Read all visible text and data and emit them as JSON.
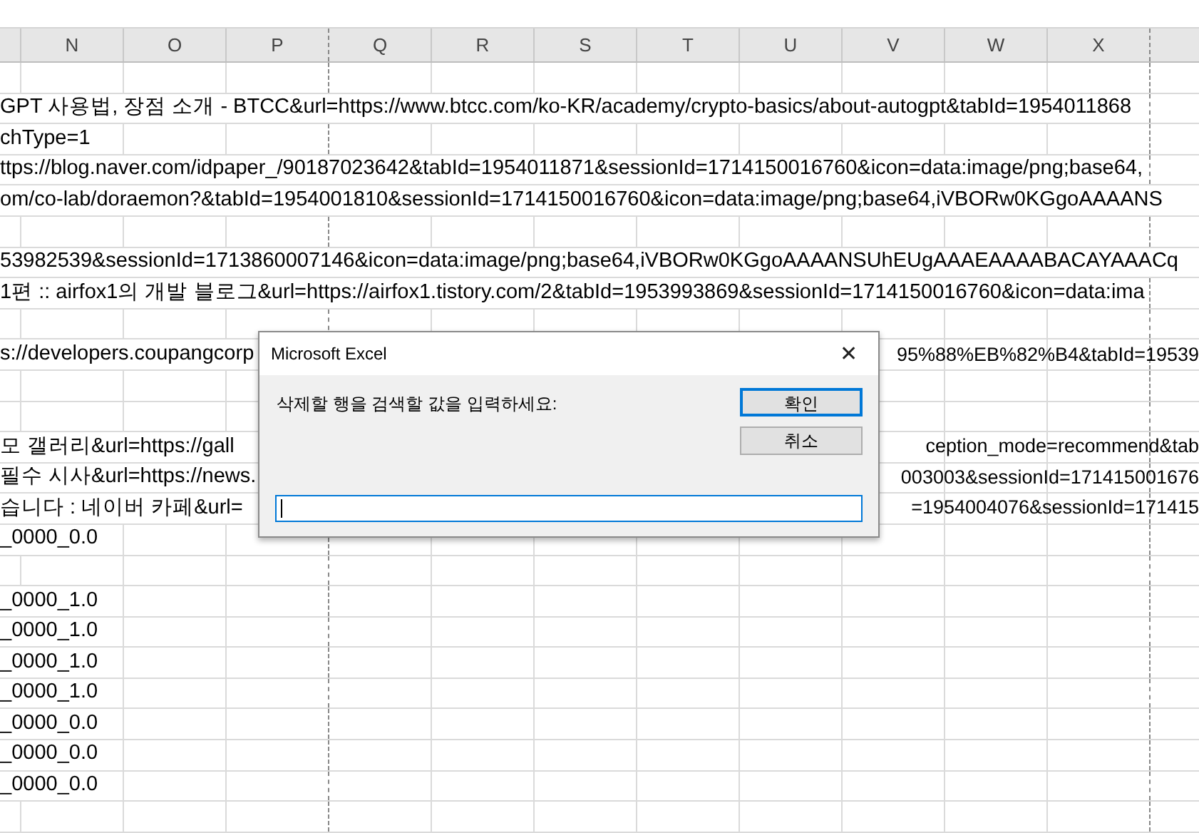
{
  "column_headers": [
    "N",
    "O",
    "P",
    "Q",
    "R",
    "S",
    "T",
    "U",
    "V",
    "W",
    "X"
  ],
  "rows": [
    {},
    {
      "text": "GPT 사용법, 장점 소개 - BTCC&url=https://www.btcc.com/ko-KR/academy/crypto-basics/about-autogpt&tabId=1954011868"
    },
    {
      "text": "chType=1"
    },
    {
      "text": "ttps://blog.naver.com/idpaper_/90187023642&tabId=1954011871&sessionId=1714150016760&icon=data:image/png;base64,"
    },
    {
      "text": "om/co-lab/doraemon?&tabId=1954001810&sessionId=1714150016760&icon=data:image/png;base64,iVBORw0KGgoAAAANS"
    },
    {},
    {
      "text": "53982539&sessionId=1713860007146&icon=data:image/png;base64,iVBORw0KGgoAAAANSUhEUgAAAEAAAABACAYAAACq"
    },
    {
      "text": "1편 :: airfox1의 개발 블로그&url=https://airfox1.tistory.com/2&tabId=1953993869&sessionId=1714150016760&icon=data:ima"
    },
    {},
    {
      "text": "s://developers.coupangcorp",
      "text_right": "95%88%EB%82%B4&tabId=19539"
    },
    {},
    {},
    {
      "text": "모 갤러리&url=https://gall",
      "text_right": "ception_mode=recommend&tab"
    },
    {
      "text": "필수 시사&url=https://news.",
      "text_right": "003003&sessionId=171415001676"
    },
    {
      "text": "습니다 : 네이버 카페&url=",
      "text_right": "=1954004076&sessionId=171415"
    },
    {
      "text": "_0000_0.0"
    },
    {},
    {
      "text": "_0000_1.0"
    },
    {
      "text": "_0000_1.0"
    },
    {
      "text": "_0000_1.0"
    },
    {
      "text": "_0000_1.0"
    },
    {
      "text": "_0000_0.0"
    },
    {
      "text": "_0000_0.0"
    },
    {
      "text": "_0000_0.0"
    },
    {}
  ],
  "dialog": {
    "title": "Microsoft Excel",
    "close": "✕",
    "prompt": "삭제할 행을 검색할 값을 입력하세요:",
    "buttons": [
      {
        "label": "확인",
        "selected": true
      },
      {
        "label": "취소",
        "selected": false
      }
    ],
    "input": {
      "focused": true
    }
  }
}
